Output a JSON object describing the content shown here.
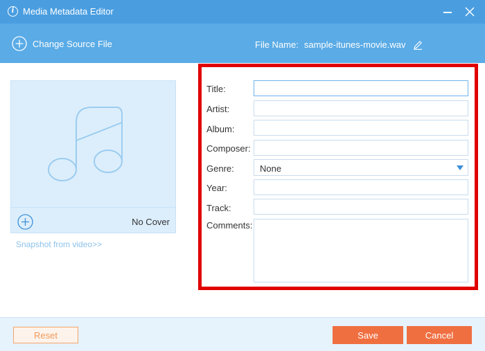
{
  "window": {
    "title": "Media Metadata Editor",
    "controls": {
      "minimize_icon": "minimize-icon",
      "close_icon": "close-icon"
    }
  },
  "toolbar": {
    "change_source_label": "Change Source File",
    "file_name_label": "File Name:",
    "file_name": "sample-itunes-movie.wav",
    "edit_icon": "pencil-icon"
  },
  "cover": {
    "placeholder_icon": "music-note-icon",
    "add_icon": "plus-circle-icon",
    "no_cover_label": "No Cover",
    "snapshot_link": "Snapshot from video>>"
  },
  "form": {
    "highlight_color": "#e00000",
    "fields": {
      "title": {
        "label": "Title:",
        "value": ""
      },
      "artist": {
        "label": "Artist:",
        "value": ""
      },
      "album": {
        "label": "Album:",
        "value": ""
      },
      "composer": {
        "label": "Composer:",
        "value": ""
      },
      "genre": {
        "label": "Genre:",
        "value": "None"
      },
      "year": {
        "label": "Year:",
        "value": ""
      },
      "track": {
        "label": "Track:",
        "value": ""
      },
      "comments": {
        "label": "Comments:",
        "value": ""
      }
    }
  },
  "footer": {
    "reset_label": "Reset",
    "save_label": "Save",
    "cancel_label": "Cancel"
  },
  "colors": {
    "titlebar": "#4a9ee0",
    "toolbar": "#5aabe6",
    "accent_orange": "#f06f41"
  }
}
